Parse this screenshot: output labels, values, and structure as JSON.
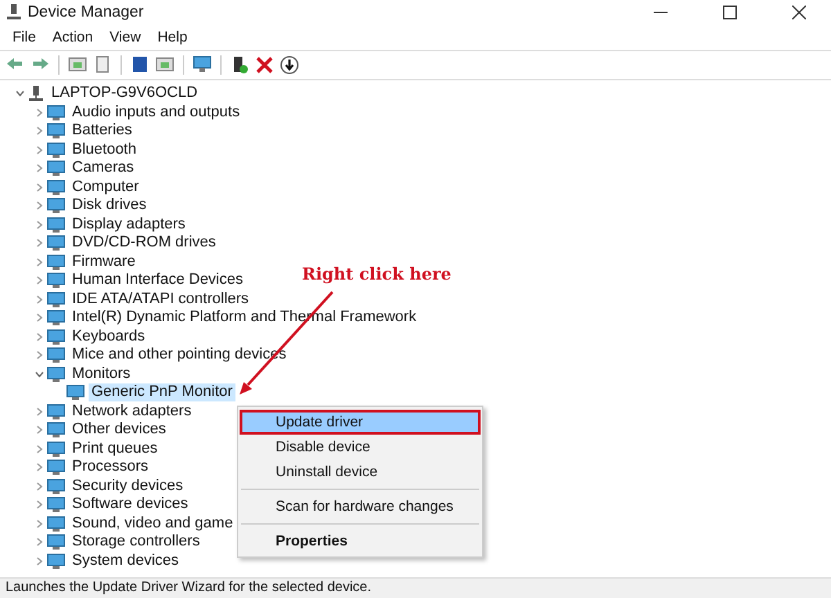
{
  "window": {
    "title": "Device Manager"
  },
  "menu": [
    "File",
    "Action",
    "View",
    "Help"
  ],
  "tree": {
    "label": "LAPTOP-G9V6OCLD",
    "expanded": true,
    "selected": false,
    "children": [
      {
        "label": "Audio inputs and outputs",
        "expanded": false,
        "selected": false
      },
      {
        "label": "Batteries",
        "expanded": false,
        "selected": false
      },
      {
        "label": "Bluetooth",
        "expanded": false,
        "selected": false
      },
      {
        "label": "Cameras",
        "expanded": false,
        "selected": false
      },
      {
        "label": "Computer",
        "expanded": false,
        "selected": false
      },
      {
        "label": "Disk drives",
        "expanded": false,
        "selected": false
      },
      {
        "label": "Display adapters",
        "expanded": false,
        "selected": false
      },
      {
        "label": "DVD/CD-ROM drives",
        "expanded": false,
        "selected": false
      },
      {
        "label": "Firmware",
        "expanded": false,
        "selected": false
      },
      {
        "label": "Human Interface Devices",
        "expanded": false,
        "selected": false
      },
      {
        "label": "IDE ATA/ATAPI controllers",
        "expanded": false,
        "selected": false
      },
      {
        "label": "Intel(R) Dynamic Platform and Thermal Framework",
        "expanded": false,
        "selected": false
      },
      {
        "label": "Keyboards",
        "expanded": false,
        "selected": false
      },
      {
        "label": "Mice and other pointing devices",
        "expanded": false,
        "selected": false
      },
      {
        "label": "Monitors",
        "expanded": true,
        "selected": false,
        "children": [
          {
            "label": "Generic PnP Monitor",
            "selected": true
          }
        ]
      },
      {
        "label": "Network adapters",
        "expanded": false,
        "selected": false
      },
      {
        "label": "Other devices",
        "expanded": false,
        "selected": false
      },
      {
        "label": "Print queues",
        "expanded": false,
        "selected": false
      },
      {
        "label": "Processors",
        "expanded": false,
        "selected": false
      },
      {
        "label": "Security devices",
        "expanded": false,
        "selected": false
      },
      {
        "label": "Software devices",
        "expanded": false,
        "selected": false
      },
      {
        "label": "Sound, video and game",
        "expanded": false,
        "selected": false
      },
      {
        "label": "Storage controllers",
        "expanded": false,
        "selected": false
      },
      {
        "label": "System devices",
        "expanded": false,
        "selected": false
      }
    ]
  },
  "context_menu": {
    "items": [
      {
        "kind": "item",
        "label": "Update driver",
        "selected": true,
        "circled": true
      },
      {
        "kind": "item",
        "label": "Disable device",
        "selected": false,
        "circled": false
      },
      {
        "kind": "item",
        "label": "Uninstall device",
        "selected": false,
        "circled": false
      },
      {
        "kind": "separator"
      },
      {
        "kind": "item",
        "label": "Scan for hardware changes",
        "selected": false,
        "circled": false
      },
      {
        "kind": "separator"
      },
      {
        "kind": "default",
        "label": "Properties",
        "selected": false,
        "circled": false
      }
    ]
  },
  "annotation": {
    "text": "Right click here"
  },
  "status_bar": "Launches the Update Driver Wizard for the selected device."
}
